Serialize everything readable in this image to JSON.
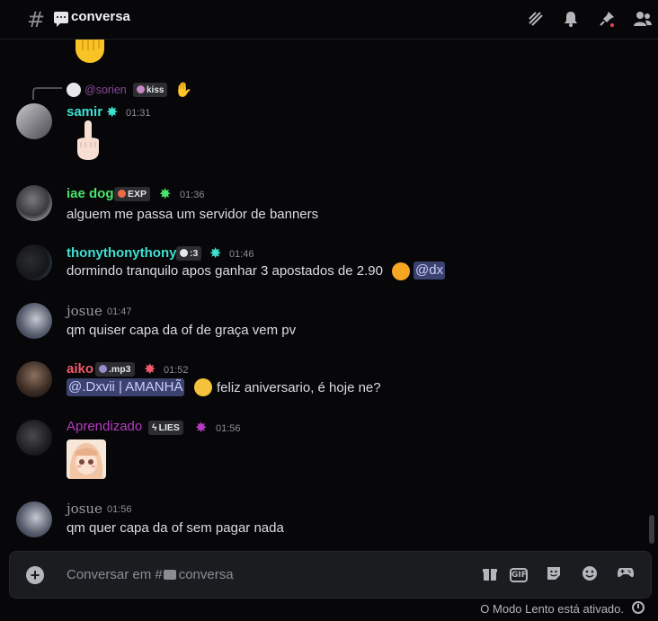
{
  "header": {
    "channel_name": "conversa",
    "icons": [
      "threads-icon",
      "bell-icon",
      "pin-icon",
      "members-icon"
    ]
  },
  "messages": [
    {
      "reply": {
        "author": "@sorien",
        "tag": "kiss"
      },
      "author": "samir",
      "author_color": "#3ee0d0",
      "badge": "star-badge",
      "time": "01:31",
      "content_kind": "emoji"
    },
    {
      "author": "iae dog",
      "author_color": "#4ae36b",
      "tag": "EXP",
      "badge": "star-badge",
      "time": "01:36",
      "text": "alguem me passa um servidor de banners"
    },
    {
      "author": "thonythonythony",
      "author_color": "#3ee0d0",
      "tag": ":3",
      "badge": "star-badge",
      "time": "01:46",
      "text": "dormindo tranquilo apos ganhar 3 apostados de 2.90",
      "mention": "@dx"
    },
    {
      "author": "josue",
      "author_color": "#9a9ca3",
      "time": "01:47",
      "text": "qm quiser capa da of de graça vem pv"
    },
    {
      "author": "aiko",
      "author_color": "#ef5a6a",
      "tag": ".mp3",
      "badge": "star-badge",
      "time": "01:52",
      "mention": "@.Dxvii | AMANHÃ",
      "text": "feliz aniversario, é hoje ne?"
    },
    {
      "author": "Aprendizado",
      "author_color": "#b63ac2",
      "tag": "LIES",
      "badge": "star-badge",
      "time": "01:56",
      "content_kind": "sticker"
    },
    {
      "author": "josue",
      "author_color": "#9a9ca3",
      "time": "01:56",
      "text": "qm quer capa da of sem pagar nada"
    }
  ],
  "composer": {
    "placeholder": "Conversar em #",
    "placeholder_channel": "conversa",
    "gif_label": "GIF"
  },
  "footer": {
    "slowmode": "O Modo Lento está ativado."
  }
}
